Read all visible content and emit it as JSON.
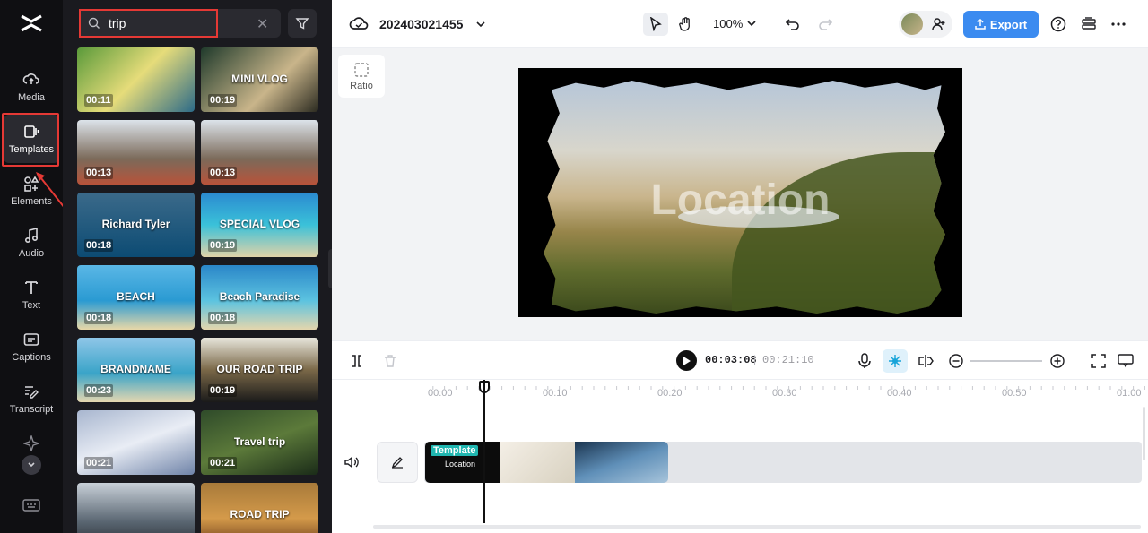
{
  "rail": {
    "items": [
      {
        "label": "Media"
      },
      {
        "label": "Templates"
      },
      {
        "label": "Elements"
      },
      {
        "label": "Audio"
      },
      {
        "label": "Text"
      },
      {
        "label": "Captions"
      },
      {
        "label": "Transcript"
      }
    ],
    "active_item": "Templates"
  },
  "search": {
    "query": "trip"
  },
  "templates": [
    {
      "duration": "00:11",
      "title": ""
    },
    {
      "duration": "00:19",
      "title": "MINI VLOG"
    },
    {
      "duration": "00:13",
      "title": ""
    },
    {
      "duration": "00:13",
      "title": ""
    },
    {
      "duration": "00:18",
      "title": "Richard Tyler"
    },
    {
      "duration": "00:19",
      "title": "SPECIAL VLOG"
    },
    {
      "duration": "00:18",
      "title": "BEACH"
    },
    {
      "duration": "00:18",
      "title": "Beach Paradise"
    },
    {
      "duration": "00:23",
      "title": "BRANDNAME"
    },
    {
      "duration": "00:19",
      "title": "OUR ROAD TRIP"
    },
    {
      "duration": "00:21",
      "title": ""
    },
    {
      "duration": "00:21",
      "title": "Travel trip"
    },
    {
      "duration": "",
      "title": ""
    },
    {
      "duration": "",
      "title": "ROAD TRIP"
    }
  ],
  "topbar": {
    "project_name": "202403021455",
    "zoom": "100%",
    "export_label": "Export"
  },
  "canvas": {
    "ratio_label": "Ratio",
    "overlay_text": "Location"
  },
  "playback": {
    "current_time": "00:03:08",
    "separator": "|",
    "total_time": "00:21:10"
  },
  "timeline": {
    "ticks": [
      "00:00",
      "00:10",
      "00:20",
      "00:30",
      "00:40",
      "00:50",
      "01:00"
    ],
    "clip_label": "Template",
    "clip_sub": "Location"
  },
  "colors": {
    "accent": "#3b8bf0",
    "highlight": "#e53935",
    "template_tag": "#20b6b0",
    "panel_bg": "#1a1a1f",
    "rail_bg": "#0f0f12"
  }
}
